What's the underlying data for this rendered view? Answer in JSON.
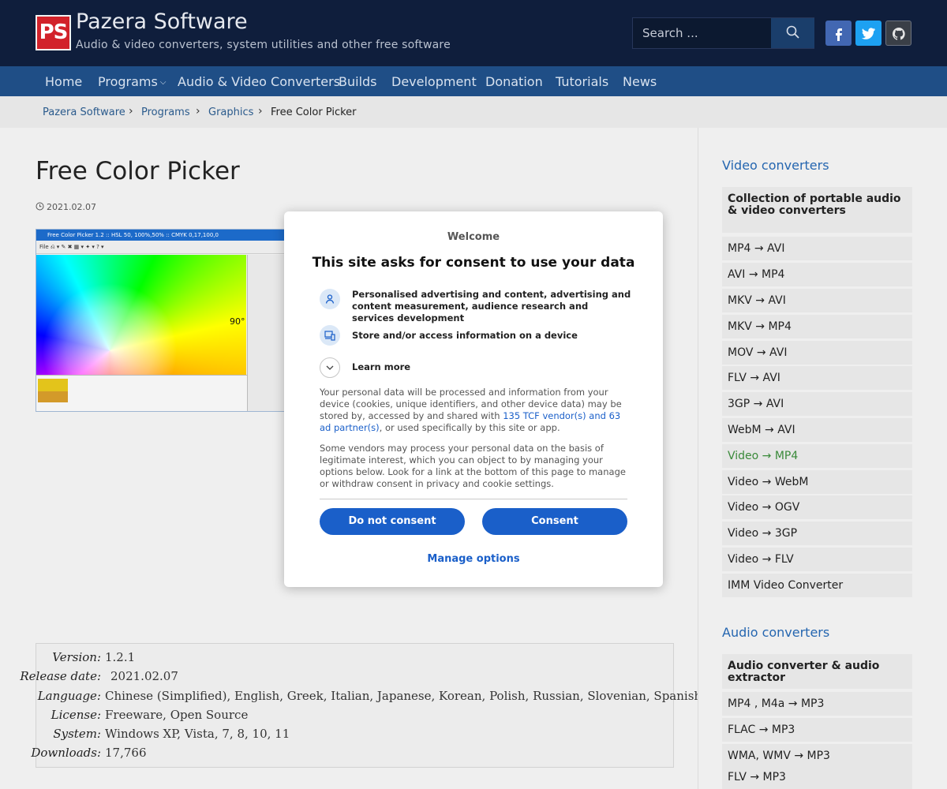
{
  "header": {
    "logo_text": "PS",
    "site_title": "Pazera Software",
    "tagline": "Audio & video converters, system utilities and other free software",
    "search_placeholder": "Search ..."
  },
  "nav": {
    "items": [
      "Home",
      "Programs",
      "Audio & Video Converters",
      "Builds",
      "Development",
      "Donation",
      "Tutorials",
      "News"
    ],
    "dropdown_chevron": "⌵"
  },
  "breadcrumb": {
    "items": [
      "Pazera Software",
      "Programs",
      "Graphics"
    ],
    "current": "Free Color Picker",
    "separator": "›"
  },
  "main": {
    "title": "Free Color Picker",
    "date": "2021.02.07",
    "screenshot": {
      "window_title": "Free Color Picker 1.2 :: HSL 50, 100%,50% :: CMYK 0,17,100,0",
      "toolbar_text": "File  ⎌ ▾  ✎  ✖  ▦ ▾  ✦ ▾  ? ▾",
      "degree_label": "90°"
    },
    "info": [
      {
        "label": "Version:",
        "value": "1.2.1"
      },
      {
        "label": "Release date:",
        "value": "2021.02.07"
      },
      {
        "label": "Language:",
        "value": "Chinese (Simplified), English, Greek, Italian, Japanese, Korean, Polish, Russian, Slovenian, Spanish"
      },
      {
        "label": "License:",
        "value": "Freeware, Open Source"
      },
      {
        "label": "System:",
        "value": "Windows XP, Vista, 7, 8, 10, 11"
      },
      {
        "label": "Downloads:",
        "value": "17,766"
      }
    ]
  },
  "sidebar": {
    "video_heading": "Video converters",
    "video_items": [
      "Collection of portable audio & video converters",
      "MP4 → AVI",
      "AVI → MP4",
      "MKV → AVI",
      "MKV → MP4",
      "MOV → AVI",
      "FLV → AVI",
      "3GP → AVI",
      "WebM → AVI",
      "Video → MP4",
      "Video → WebM",
      "Video → OGV",
      "Video → 3GP",
      "Video → FLV",
      "IMM Video Converter"
    ],
    "audio_heading": "Audio converters",
    "audio_items": [
      "Audio converter & audio extractor",
      "MP4 , M4a → MP3",
      "FLAC → MP3",
      "WMA, WMV → MP3",
      "FLV → MP3"
    ]
  },
  "consent": {
    "welcome": "Welcome",
    "title": "This site asks for consent to use your data",
    "purpose_1": "Personalised advertising and content, advertising and content measurement, audience research and services development",
    "purpose_2": "Store and/or access information on a device",
    "learn_more": "Learn more",
    "para_1_before": "Your personal data will be processed and information from your device (cookies, unique identifiers, and other device data) may be stored by, accessed by and shared with ",
    "para_1_link": "135 TCF vendor(s) and 63 ad partner(s)",
    "para_1_after": ", or used specifically by this site or app.",
    "para_2": "Some vendors may process your personal data on the basis of legitimate interest, which you can object to by managing your options below. Look for a link at the bottom of this page to manage or withdraw consent in privacy and cookie settings.",
    "do_not_consent": "Do not consent",
    "consent": "Consent",
    "manage_options": "Manage options"
  },
  "colors": {
    "header_bg": "#0f1e3c",
    "nav_bg": "#1f4e86",
    "accent_blue": "#1a5fc9",
    "link_blue": "#2566b0",
    "active_green": "#3a8a3a"
  }
}
